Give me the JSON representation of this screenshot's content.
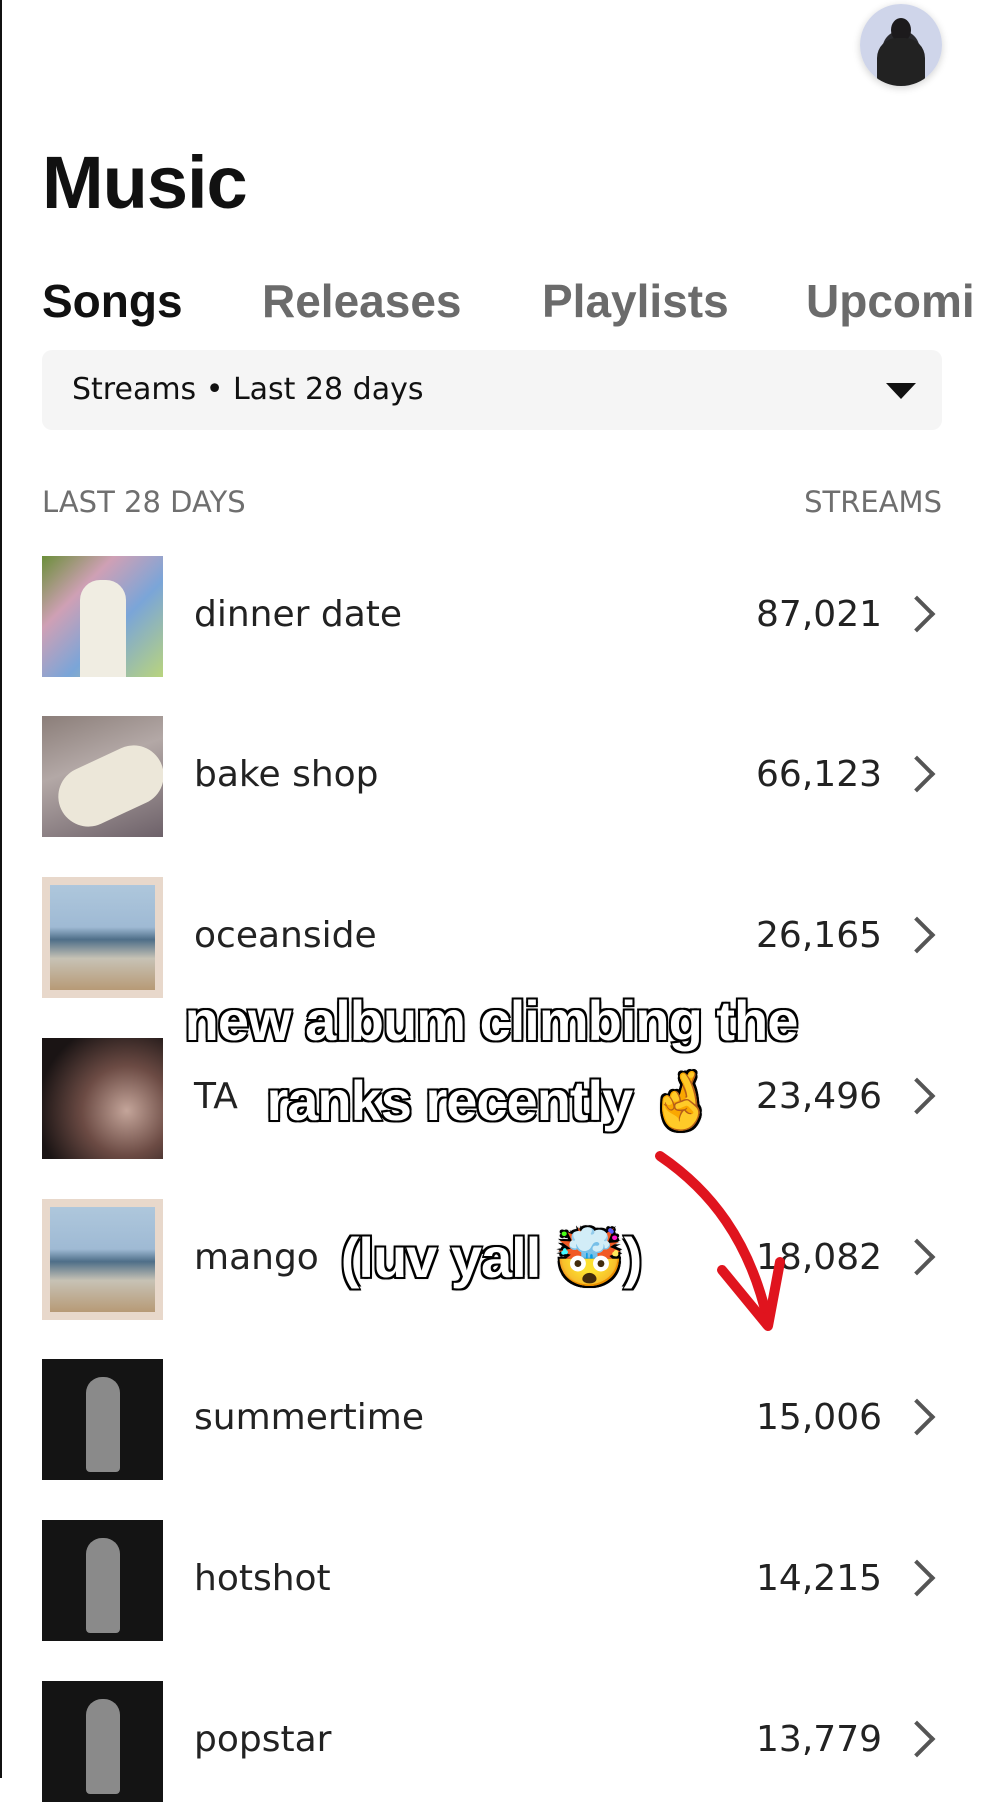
{
  "page_title": "Music",
  "tabs": [
    {
      "label": "Songs",
      "active": true
    },
    {
      "label": "Releases",
      "active": false
    },
    {
      "label": "Playlists",
      "active": false
    },
    {
      "label": "Upcomi",
      "active": false
    }
  ],
  "filter": {
    "label": "Streams • Last 28 days",
    "icon": "caret-down-icon"
  },
  "list_header": {
    "left": "LAST 28 DAYS",
    "right": "STREAMS"
  },
  "songs": [
    {
      "name": "dinner date",
      "streams": "87,021"
    },
    {
      "name": "bake shop",
      "streams": "66,123"
    },
    {
      "name": "oceanside",
      "streams": "26,165"
    },
    {
      "name": "TA",
      "streams": "23,496"
    },
    {
      "name": "mango",
      "streams": "18,082"
    },
    {
      "name": "summertime",
      "streams": "15,006"
    },
    {
      "name": "hotshot",
      "streams": "14,215"
    },
    {
      "name": "popstar",
      "streams": "13,779"
    }
  ],
  "overlay": {
    "line1": "new album climbing the",
    "line2": "ranks recently 🤞",
    "line3": "(luv yall 🤯)",
    "arrow_color": "#e0141e"
  },
  "colors": {
    "background": "#ffffff",
    "muted": "#6b6b6b",
    "filter_bg": "#f5f5f5"
  }
}
